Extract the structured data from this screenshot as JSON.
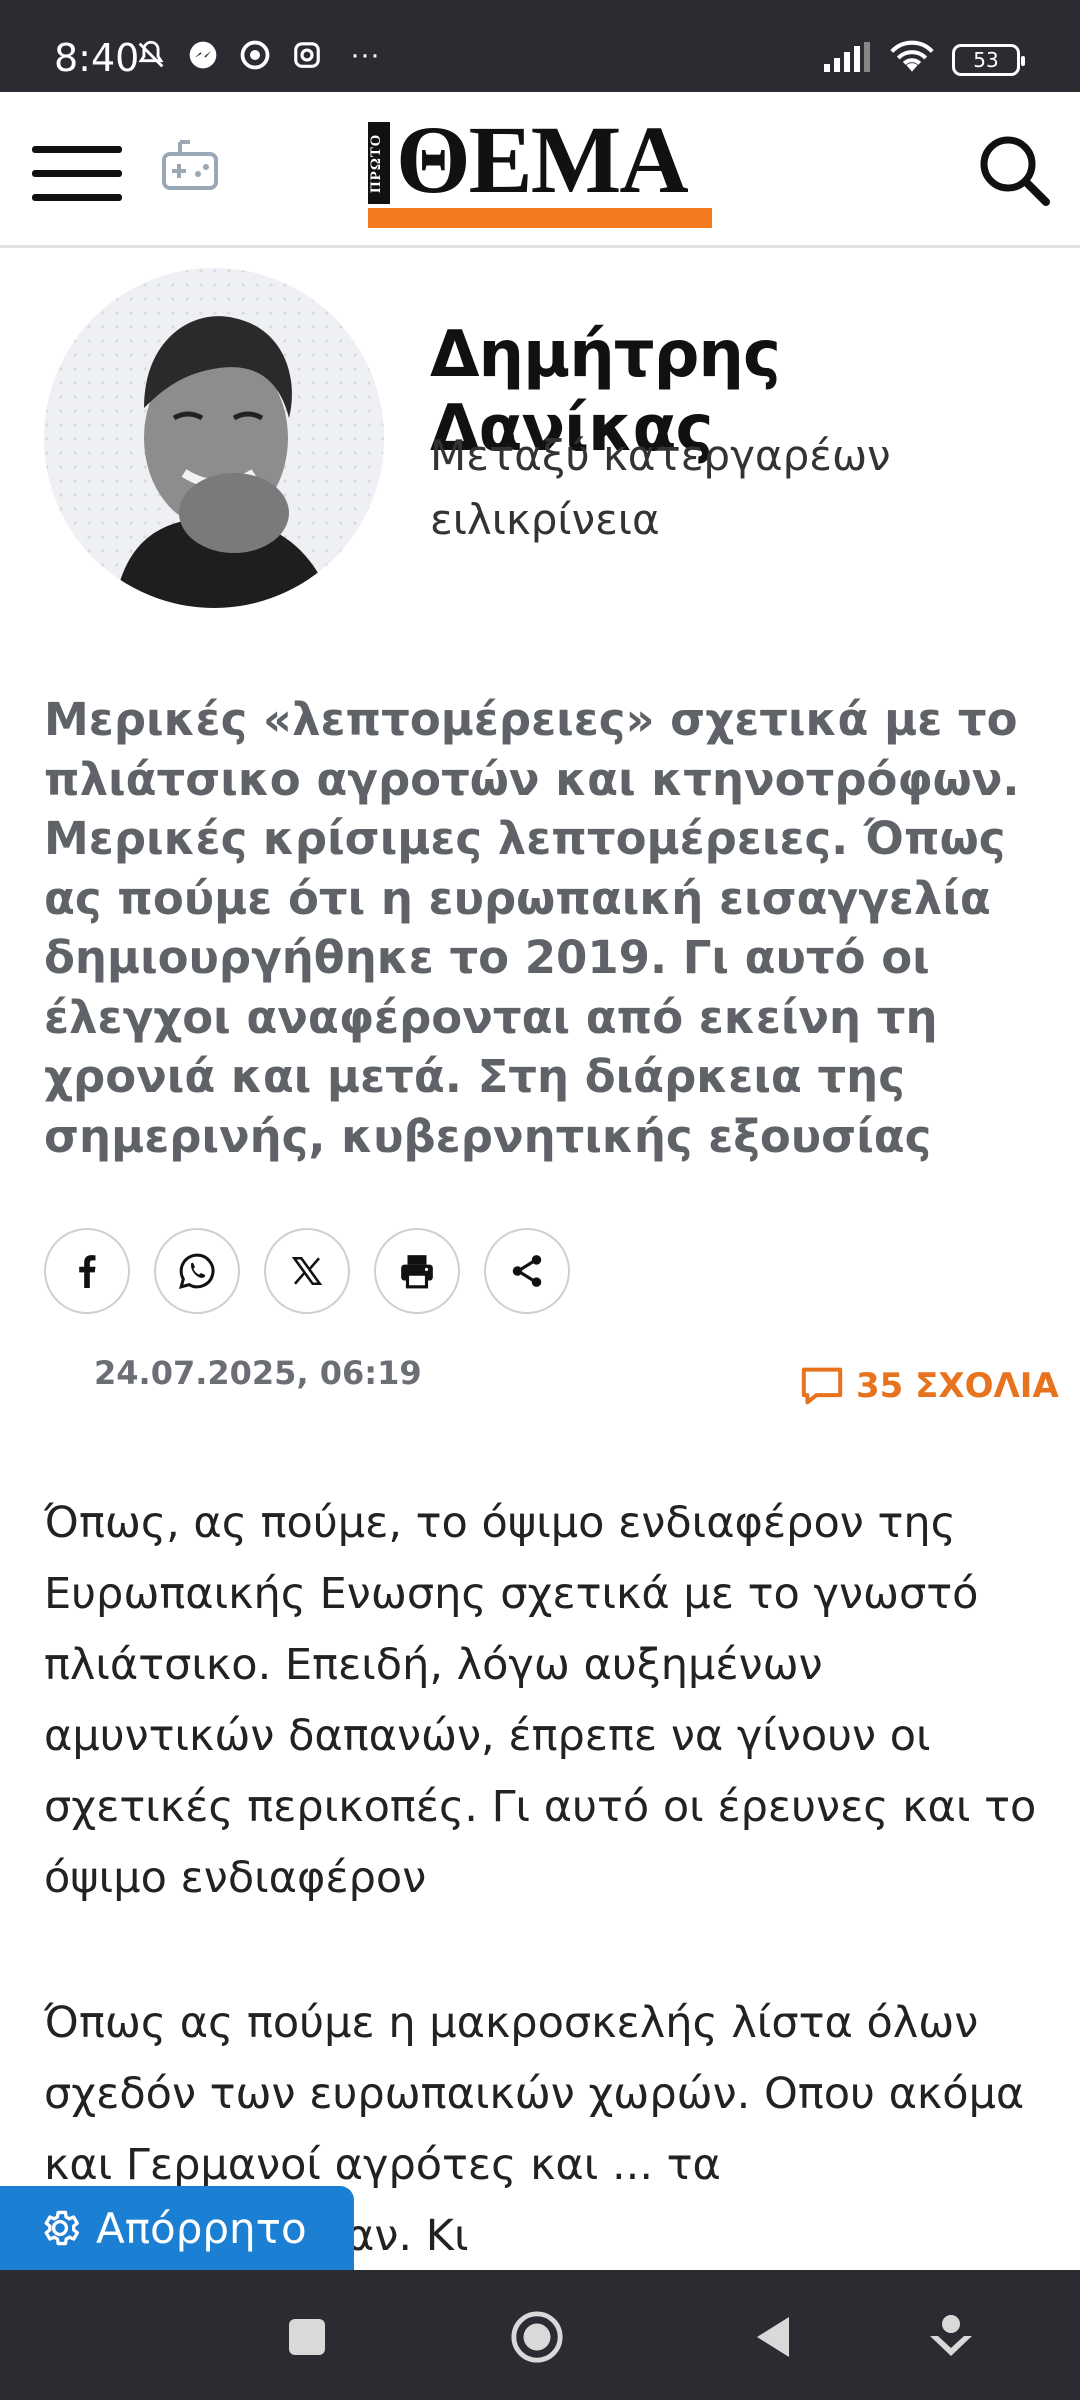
{
  "status_bar": {
    "time": "8:40",
    "more": "···",
    "battery": "53"
  },
  "header": {
    "logo_small": "ΠΡΩΤΟ",
    "logo_main": "ΘΕΜΑ",
    "logo_accent_color": "#f47a20"
  },
  "author": {
    "name": "Δημήτρης Δανίκας",
    "column_line1": "Μεταξύ κατεργαρέων",
    "column_line2": "ειλικρίνεια"
  },
  "lead": "Μερικές «λεπτομέρειες» σχετικά με το πλιάτσικο αγροτών και κτηνοτρόφων. Μερικές κρίσιμες λεπτομέρειες. Όπως ας πούμε ότι η ευρωπαική εισαγγελία δημιουργήθηκε το 2019. Γι αυτό οι έλεγχοι αναφέρονται από εκείνη τη χρονιά και μετά. Στη διάρκεια της σημερινής, κυβερνητικής εξουσίας",
  "share": [
    "facebook-icon",
    "whatsapp-icon",
    "x-icon",
    "print-icon",
    "share-icon"
  ],
  "meta": {
    "date": "24.07.2025, 06:19",
    "comments": "35 ΣΧΟΛΙΑ",
    "comments_color": "#e8731f"
  },
  "body": {
    "p1": "Όπως, ας πούμε, το όψιμο ενδιαφέρον της Ευρωπαικής Ενωσης σχετικά με το γνωστό πλιάτσικο. Επειδή, λόγω αυξημένων αμυντικών δαπανών, έπρεπε να γίνουν οι σχετικές περικοπές. Γι αυτό οι έρευνες και το όψιμο ενδιαφέρον",
    "p2": "Όπως ας πούμε η μακροσκελής λίστα όλων σχεδόν των ευρωπαικών χωρών. Οπου ακόμα και Γερμανοί αγρότες και ... τα παραφούσκωναν. Κι"
  },
  "floating_button": {
    "label": "Απόρρητο",
    "color": "#1b7fd4"
  }
}
